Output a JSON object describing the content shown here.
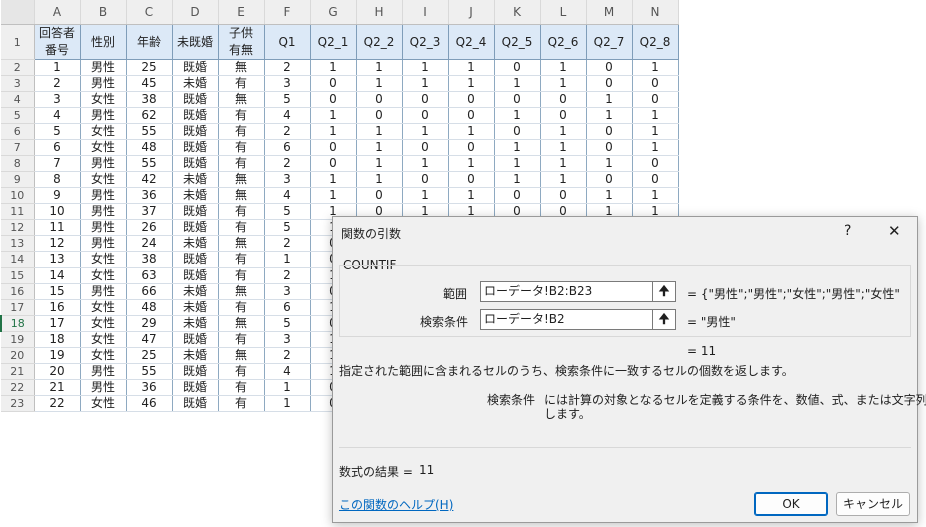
{
  "sheet": {
    "column_letters": [
      "A",
      "B",
      "C",
      "D",
      "E",
      "F",
      "G",
      "H",
      "I",
      "J",
      "K",
      "L",
      "M",
      "N"
    ],
    "header_labels": [
      "回答者\n番号",
      "性別",
      "年齢",
      "未既婚",
      "子供\n有無",
      "Q1",
      "Q2_1",
      "Q2_2",
      "Q2_3",
      "Q2_4",
      "Q2_5",
      "Q2_6",
      "Q2_7",
      "Q2_8"
    ],
    "row_numbers": [
      "1",
      "2",
      "3",
      "4",
      "5",
      "6",
      "7",
      "8",
      "9",
      "10",
      "11",
      "12",
      "13",
      "14",
      "15",
      "16",
      "17",
      "18",
      "19",
      "20",
      "21",
      "22",
      "23"
    ],
    "rows": [
      [
        "1",
        "男性",
        "25",
        "既婚",
        "無",
        "2",
        "1",
        "1",
        "1",
        "1",
        "0",
        "1",
        "0",
        "1"
      ],
      [
        "2",
        "男性",
        "45",
        "未婚",
        "有",
        "3",
        "0",
        "1",
        "1",
        "1",
        "1",
        "1",
        "0",
        "0"
      ],
      [
        "3",
        "女性",
        "38",
        "既婚",
        "無",
        "5",
        "0",
        "0",
        "0",
        "0",
        "0",
        "0",
        "1",
        "0"
      ],
      [
        "4",
        "男性",
        "62",
        "既婚",
        "有",
        "4",
        "1",
        "0",
        "0",
        "0",
        "1",
        "0",
        "1",
        "1"
      ],
      [
        "5",
        "女性",
        "55",
        "既婚",
        "有",
        "2",
        "1",
        "1",
        "1",
        "1",
        "0",
        "1",
        "0",
        "1"
      ],
      [
        "6",
        "女性",
        "48",
        "既婚",
        "有",
        "6",
        "0",
        "1",
        "0",
        "0",
        "1",
        "1",
        "0",
        "1"
      ],
      [
        "7",
        "男性",
        "55",
        "既婚",
        "有",
        "2",
        "0",
        "1",
        "1",
        "1",
        "1",
        "1",
        "1",
        "0"
      ],
      [
        "8",
        "女性",
        "42",
        "未婚",
        "無",
        "3",
        "1",
        "1",
        "0",
        "0",
        "1",
        "1",
        "0",
        "0"
      ],
      [
        "9",
        "男性",
        "36",
        "未婚",
        "無",
        "4",
        "1",
        "0",
        "1",
        "1",
        "0",
        "0",
        "1",
        "1"
      ],
      [
        "10",
        "男性",
        "37",
        "既婚",
        "有",
        "5",
        "1",
        "0",
        "1",
        "1",
        "0",
        "0",
        "1",
        "1"
      ],
      [
        "11",
        "男性",
        "26",
        "既婚",
        "有",
        "5",
        "1",
        "",
        "",
        "",
        "",
        "",
        "",
        ""
      ],
      [
        "12",
        "男性",
        "24",
        "未婚",
        "無",
        "2",
        "0",
        "",
        "",
        "",
        "",
        "",
        "",
        ""
      ],
      [
        "13",
        "女性",
        "38",
        "既婚",
        "有",
        "1",
        "0",
        "",
        "",
        "",
        "",
        "",
        "",
        ""
      ],
      [
        "14",
        "女性",
        "63",
        "既婚",
        "有",
        "2",
        "1",
        "",
        "",
        "",
        "",
        "",
        "",
        ""
      ],
      [
        "15",
        "男性",
        "66",
        "未婚",
        "無",
        "3",
        "0",
        "",
        "",
        "",
        "",
        "",
        "",
        ""
      ],
      [
        "16",
        "女性",
        "48",
        "未婚",
        "有",
        "6",
        "1",
        "",
        "",
        "",
        "",
        "",
        "",
        ""
      ],
      [
        "17",
        "女性",
        "29",
        "未婚",
        "無",
        "5",
        "0",
        "",
        "",
        "",
        "",
        "",
        "",
        ""
      ],
      [
        "18",
        "女性",
        "47",
        "既婚",
        "有",
        "3",
        "1",
        "",
        "",
        "",
        "",
        "",
        "",
        ""
      ],
      [
        "19",
        "女性",
        "25",
        "未婚",
        "無",
        "2",
        "1",
        "",
        "",
        "",
        "",
        "",
        "",
        ""
      ],
      [
        "20",
        "男性",
        "55",
        "既婚",
        "有",
        "4",
        "1",
        "",
        "",
        "",
        "",
        "",
        "",
        ""
      ],
      [
        "21",
        "男性",
        "36",
        "既婚",
        "有",
        "1",
        "0",
        "",
        "",
        "",
        "",
        "",
        "",
        ""
      ],
      [
        "22",
        "女性",
        "46",
        "既婚",
        "有",
        "1",
        "0",
        "",
        "",
        "",
        "",
        "",
        "",
        ""
      ]
    ]
  },
  "dialog": {
    "title": "関数の引数",
    "help_icon": "?",
    "close_icon": "✕",
    "function_name": "COUNTIF",
    "range_label": "範囲",
    "range_value": "ローデータ!B2:B23",
    "range_result": "=  {\"男性\";\"男性\";\"女性\";\"男性\";\"女性\"",
    "criteria_label": "検索条件",
    "criteria_value": "ローデータ!B2",
    "criteria_result": "=  \"男性\"",
    "result_line": "=   11",
    "description": "指定された範囲に含まれるセルのうち、検索条件に一致するセルの個数を返します。",
    "arg_name": "検索条件",
    "arg_desc_line1": "には計算の対象となるセルを定義する条件を、数値、式、または文字列で指定",
    "arg_desc_line2": "します。",
    "formula_result_label": "数式の結果 =",
    "formula_result_value": "11",
    "help_link": "この関数のヘルプ(H)",
    "ok_label": "OK",
    "cancel_label": "キャンセル",
    "ref_icon": "🠉"
  },
  "colors": {
    "header_fill": "#dce9f7",
    "accent": "#217346",
    "link": "#0067c0"
  }
}
